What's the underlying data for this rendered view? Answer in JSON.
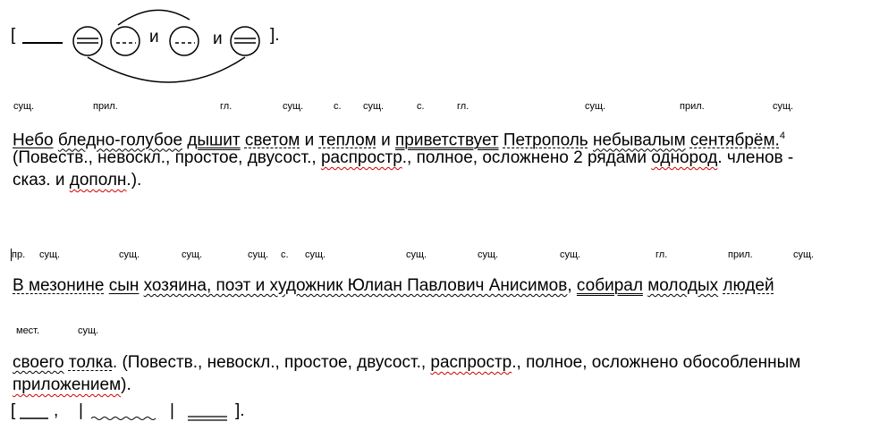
{
  "scheme1": {
    "open_bracket": "[",
    "close_bracket": "].",
    "and1": "и",
    "and2": "и"
  },
  "pos_row1": [
    "сущ.",
    "прил.",
    "гл.",
    "сущ.",
    "с.",
    "сущ.",
    "с.",
    "гл.",
    "сущ.",
    "прил.",
    "сущ."
  ],
  "sentence1": {
    "w1": "Небо",
    "w2": "бледно-голубое",
    "w3": "дышит",
    "w4": "светом",
    "and1": "и",
    "w5": "теплом",
    "and2": "и",
    "w6": "приветствует",
    "w7": "Петрополь",
    "w8": "небывалым",
    "w9": "сентябрём.",
    "footnote": "4",
    "analysis_a": "(Повеств., невоскл., простое, двусост., ",
    "analysis_b": "распростр",
    "analysis_c": "., полное, осложнено 2 рядами ",
    "analysis_d": "однород",
    "analysis_e": ". членов -",
    "analysis_f": "сказ. и ",
    "analysis_g": "дополн",
    "analysis_h": ".)."
  },
  "pos_row2": [
    "пр.",
    "сущ.",
    "сущ.",
    "сущ.",
    "сущ.",
    "с.",
    "сущ.",
    "сущ.",
    "сущ.",
    "сущ.",
    "гл.",
    "прил.",
    "сущ."
  ],
  "sentence2": {
    "w1": "В мезонине",
    "w2": "сын",
    "w3": "хозяина, поэт и художник Юлиан Павлович Анисимов",
    "comma": ",",
    "w4": "собирал",
    "w5": "молодых",
    "w6": "людей"
  },
  "pos_row3": [
    "мест.",
    "сущ."
  ],
  "sentence2b": {
    "w1": "своего",
    "w2": "толка",
    "analysis_a": ". (Повеств., невоскл., простое, двусост., ",
    "analysis_b": "распростр",
    "analysis_c": "., полное, осложнено обособленным",
    "analysis_d": "приложением",
    "analysis_e": ")."
  },
  "scheme2": {
    "open": "[",
    "comma": ",",
    "bar1": "|",
    "bar2": "|",
    "close": "]."
  }
}
